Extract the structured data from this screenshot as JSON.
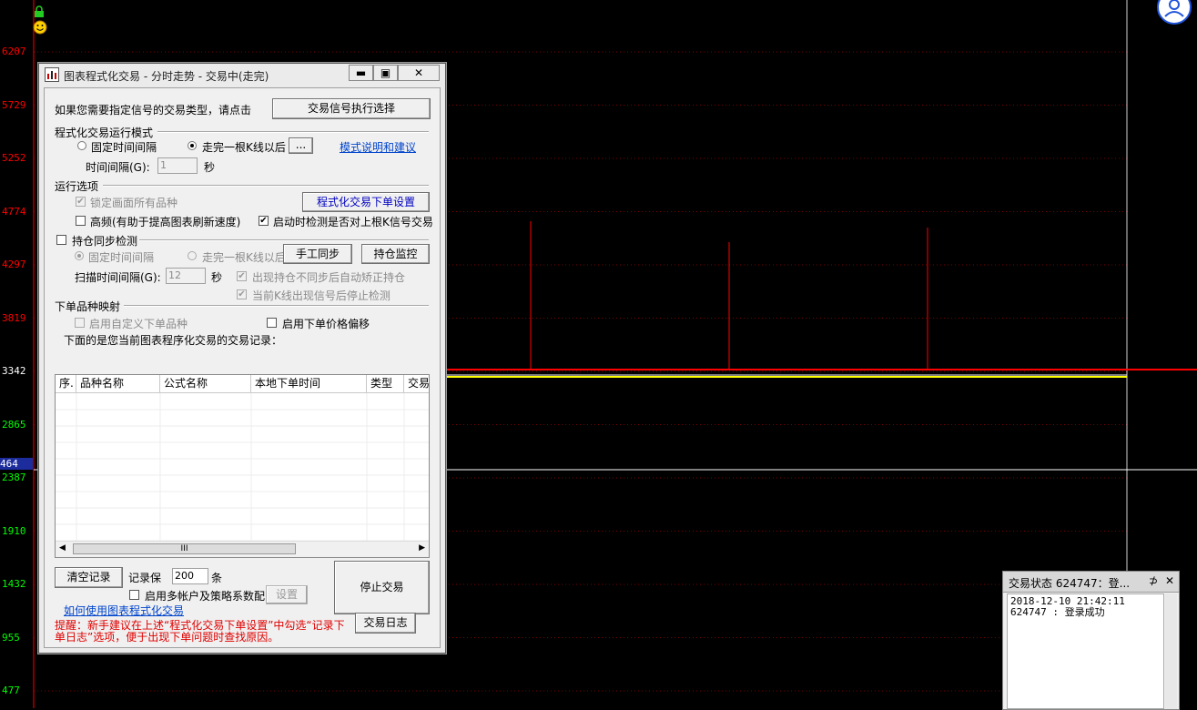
{
  "chart": {
    "y_ticks": [
      "6207",
      "5729",
      "5252",
      "4774",
      "4297",
      "3819",
      "3342",
      "2865",
      "2387",
      "1910",
      "1432",
      "955",
      "477"
    ],
    "cursor_value": "464",
    "colors": {
      "up": "#ff0000",
      "down": "#00ff00",
      "grid": "#ff0000",
      "price_line": "#ffff00",
      "cursor": "#ffffff",
      "cursor_label_bg": "#1c2c9c"
    }
  },
  "icons": [
    "lock-icon",
    "smile-icon",
    "user-icon"
  ],
  "dialog": {
    "title": "图表程式化交易 - 分时走势 - 交易中(走完)",
    "window_buttons": {
      "minimize": "▬",
      "maximize": "▣",
      "close": "✕"
    },
    "signal_prompt": "如果您需要指定信号的交易类型，请点击",
    "signal_button": "交易信号执行选择",
    "mode_section": "程式化交易运行模式",
    "mode_fixed": "固定时间间隔",
    "mode_after_k": "走完一根K线以后",
    "ellipsis_button": "...",
    "mode_help_link": "模式说明和建议",
    "interval_label": "时间间隔(G):",
    "interval_value": "1",
    "interval_unit": "秒",
    "options_section": "运行选项",
    "lock_all": "锁定画面所有品种",
    "order_settings_button": "程式化交易下单设置",
    "high_freq": "高频(有助于提高图表刷新速度)",
    "check_on_start": "启动时检测是否对上根K信号交易",
    "position_sync": "持仓同步检测",
    "sync_fixed": "固定时间间隔",
    "sync_after_k": "走完一根K线以后",
    "manual_sync_button": "手工同步",
    "position_monitor_button": "持仓监控",
    "scan_interval_label": "扫描时间间隔(G):",
    "scan_interval_value": "12",
    "scan_interval_unit": "秒",
    "auto_correct": "出现持仓不同步后自动矫正持仓",
    "stop_on_signal": "当前K线出现信号后停止检测",
    "mapping_section": "下单品种映射",
    "custom_symbol": "启用自定义下单品种",
    "price_offset": "启用下单价格偏移",
    "records_caption": "下面的是您当前图表程序化交易的交易记录：",
    "table_headers": [
      "序.",
      "品种名称",
      "公式名称",
      "本地下单时间",
      "类型",
      "交易"
    ],
    "scroll_thumb": "III",
    "clear_button": "清空记录",
    "keep_label": "记录保",
    "keep_value": "200",
    "keep_unit": "条",
    "multi_account": "启用多帐户及策略系数配",
    "settings_button": "设置",
    "stop_button": "停止交易",
    "howto_link": "如何使用图表程式化交易",
    "log_button": "交易日志",
    "warning": "提醒：新手建议在上述“程式化交易下单设置”中勾选“记录下单日志”选项，便于出现下单问题时查找原因。"
  },
  "status_panel": {
    "title": "交易状态 624747：登...",
    "pin": "⊅",
    "close": "✕",
    "line1": "2018-12-10 21:42:11",
    "line2": "624747 : 登录成功"
  }
}
